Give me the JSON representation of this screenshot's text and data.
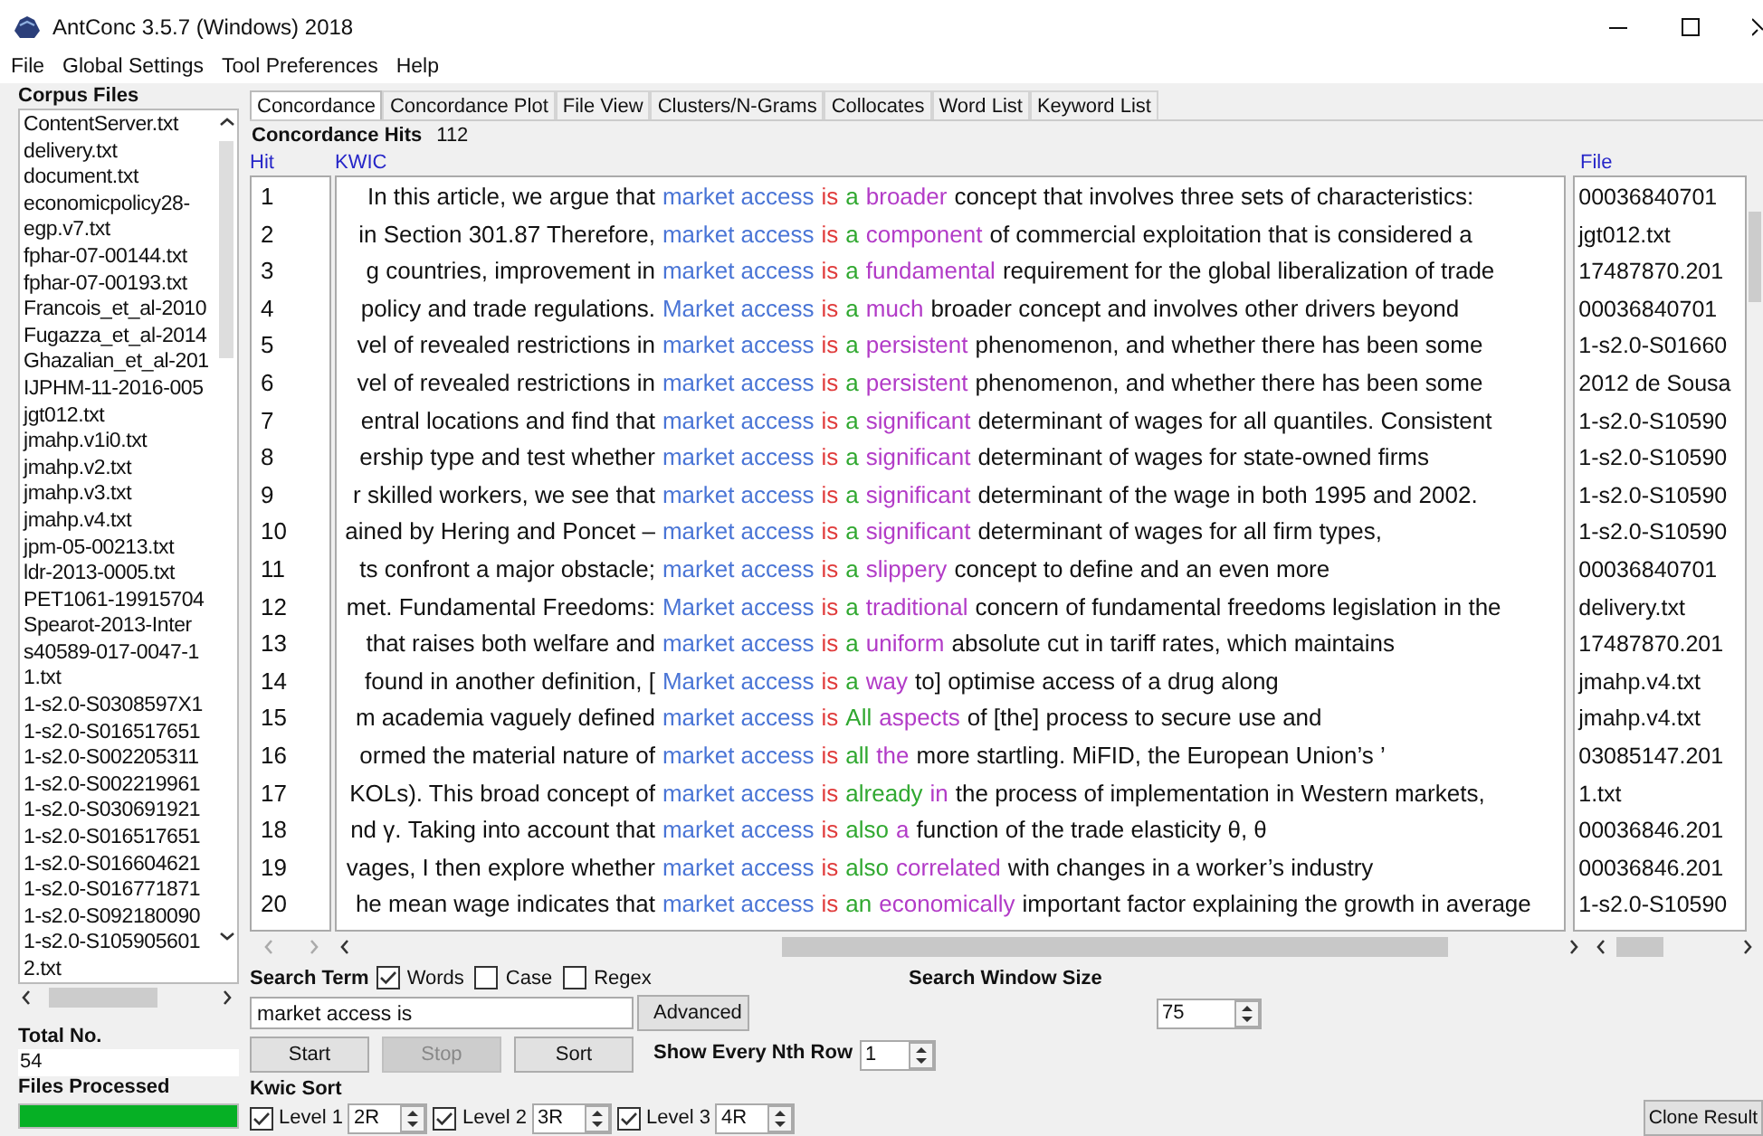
{
  "window": {
    "title": "AntConc 3.5.7 (Windows) 2018"
  },
  "menu": [
    "File",
    "Global Settings",
    "Tool Preferences",
    "Help"
  ],
  "corpus": {
    "label": "Corpus Files",
    "files": [
      "ContentServer.txt",
      "delivery.txt",
      "document.txt",
      "economicpolicy28-",
      "egp.v7.txt",
      "fphar-07-00144.txt",
      "fphar-07-00193.txt",
      "Francois_et_al-2010",
      "Fugazza_et_al-2014",
      "Ghazalian_et_al-201",
      "IJPHM-11-2016-005",
      "jgt012.txt",
      "jmahp.v1i0.txt",
      "jmahp.v2.txt",
      "jmahp.v3.txt",
      "jmahp.v4.txt",
      "jpm-05-00213.txt",
      "ldr-2013-0005.txt",
      "PET1061-19915704",
      "Spearot-2013-Inter",
      "s40589-017-0047-1",
      "1.txt",
      "1-s2.0-S0308597X1",
      "1-s2.0-S016517651",
      "1-s2.0-S002205311",
      "1-s2.0-S002219961",
      "1-s2.0-S030691921",
      "1-s2.0-S016517651",
      "1-s2.0-S016604621",
      "1-s2.0-S016771871",
      "1-s2.0-S092180090",
      "1-s2.0-S105905601",
      "2.txt"
    ],
    "total_label": "Total No.",
    "total": "54",
    "processed_label": "Files Processed",
    "progress": {
      "level": 1
    }
  },
  "tabs": [
    {
      "label": "Concordance",
      "selected": true
    },
    {
      "label": "Concordance Plot",
      "selected": false
    },
    {
      "label": "File View",
      "selected": false
    },
    {
      "label": "Clusters/N-Grams",
      "selected": false
    },
    {
      "label": "Collocates",
      "selected": false
    },
    {
      "label": "Word List",
      "selected": false
    },
    {
      "label": "Keyword List",
      "selected": false
    }
  ],
  "concordance": {
    "hits_label": "Concordance Hits",
    "hits": "112",
    "columns": [
      "Hit",
      "KWIC",
      "File"
    ],
    "rows": [
      {
        "hit": "1",
        "left": "In this article, we argue that",
        "match": "market access",
        "word_1": "is",
        "word_2": "a",
        "word_3": "broader",
        "right": "concept that involves three sets of characteristics:",
        "file": "00036840701"
      },
      {
        "hit": "2",
        "left": "in Section 301.87 Therefore,",
        "match": "market access",
        "word_1": "is",
        "word_2": "a",
        "word_3": "component",
        "right": "of commercial exploitation that is considered a",
        "file": "jgt012.txt"
      },
      {
        "hit": "3",
        "left": "g countries, improvement in",
        "match": "market access",
        "word_1": "is",
        "word_2": "a",
        "word_3": "fundamental",
        "right": "requirement for the global liberalization of trade",
        "file": "17487870.201"
      },
      {
        "hit": "4",
        "left": "policy and trade regulations.",
        "match": "Market access",
        "word_1": "is",
        "word_2": "a",
        "word_3": "much",
        "right": "broader concept and involves other drivers beyond",
        "file": "00036840701"
      },
      {
        "hit": "5",
        "left": "vel of revealed restrictions in",
        "match": "market access",
        "word_1": "is",
        "word_2": "a",
        "word_3": "persistent",
        "right": "phenomenon, and whether there has been some",
        "file": "1-s2.0-S01660"
      },
      {
        "hit": "6",
        "left": "vel of revealed restrictions in",
        "match": "market access",
        "word_1": "is",
        "word_2": "a",
        "word_3": "persistent",
        "right": "phenomenon, and whether there has been some",
        "file": "2012 de Sousa"
      },
      {
        "hit": "7",
        "left": "entral locations and find that",
        "match": "market access",
        "word_1": "is",
        "word_2": "a",
        "word_3": "significant",
        "right": "determinant of wages for all quantiles. Consistent",
        "file": "1-s2.0-S10590"
      },
      {
        "hit": "8",
        "left": "ership type and test whether",
        "match": "market access",
        "word_1": "is",
        "word_2": "a",
        "word_3": "significant",
        "right": "determinant of wages for state-owned firms",
        "file": "1-s2.0-S10590"
      },
      {
        "hit": "9",
        "left": "r skilled workers, we see that",
        "match": "market access",
        "word_1": "is",
        "word_2": "a",
        "word_3": "significant",
        "right": "determinant of the wage in both 1995 and 2002.",
        "file": "1-s2.0-S10590"
      },
      {
        "hit": "10",
        "left": "ained by Hering and Poncet –",
        "match": "market access",
        "word_1": "is",
        "word_2": "a",
        "word_3": "significant",
        "right": "determinant of wages for all firm types,",
        "file": "1-s2.0-S10590"
      },
      {
        "hit": "11",
        "left": "ts confront a major obstacle;",
        "match": "market access",
        "word_1": "is",
        "word_2": "a",
        "word_3": "slippery",
        "right": "concept to define and an even more",
        "file": "00036840701"
      },
      {
        "hit": "12",
        "left": "met. Fundamental Freedoms:",
        "match": "Market access",
        "word_1": "is",
        "word_2": "a",
        "word_3": "traditional",
        "right": "concern of fundamental freedoms legislation in the",
        "file": "delivery.txt"
      },
      {
        "hit": "13",
        "left": "that raises both welfare and",
        "match": "market access",
        "word_1": "is",
        "word_2": "a",
        "word_3": "uniform",
        "right": "absolute cut in tariff rates, which maintains",
        "file": "17487870.201"
      },
      {
        "hit": "14",
        "left": "found in another definition, [",
        "match": "Market access",
        "word_1": "is",
        "word_2": "a",
        "word_3": "way",
        "right": "to] optimise access of a drug along",
        "file": "jmahp.v4.txt"
      },
      {
        "hit": "15",
        "left": "m academia vaguely defined",
        "match": "market access",
        "word_1": "is",
        "word_2": "All",
        "word_3": "aspects",
        "right": "of [the] process to secure use and",
        "file": "jmahp.v4.txt"
      },
      {
        "hit": "16",
        "left": "ormed the material nature of",
        "match": "market access",
        "word_1": "is",
        "word_2": "all",
        "word_3": "the",
        "right": "more startling. MiFID, the European Union’s ’",
        "file": "03085147.201"
      },
      {
        "hit": "17",
        "left": "KOLs). This broad concept of",
        "match": "market access",
        "word_1": "is",
        "word_2": "already",
        "word_3": "in",
        "right": "the process of implementation in Western markets,",
        "file": "1.txt"
      },
      {
        "hit": "18",
        "left": "nd γ. Taking into account that",
        "match": "market access",
        "word_1": "is",
        "word_2": "also",
        "word_3": "a",
        "right": "function of the trade elasticity θ, θ",
        "file": "00036846.201"
      },
      {
        "hit": "19",
        "left": "vages, I then explore whether",
        "match": "market access",
        "word_1": "is",
        "word_2": "also",
        "word_3": "correlated",
        "right": "with changes in a worker’s industry",
        "file": "00036846.201"
      },
      {
        "hit": "20",
        "left": "he mean wage indicates that",
        "match": "market access",
        "word_1": "is",
        "word_2": "an",
        "word_3": "economically",
        "right": "important factor explaining the growth in average",
        "file": "1-s2.0-S10590"
      }
    ]
  },
  "search": {
    "label": "Search Term",
    "options": [
      {
        "label": "Words",
        "checked": true
      },
      {
        "label": "Case",
        "checked": false
      },
      {
        "label": "Regex",
        "checked": false
      }
    ],
    "query": "market access is",
    "advanced": "Advanced",
    "buttons": [
      {
        "label": "Start",
        "disabled": false
      },
      {
        "label": "Stop",
        "disabled": true
      },
      {
        "label": "Sort",
        "disabled": false
      }
    ],
    "nth_row_label": "Show Every Nth Row",
    "nth_row": "1",
    "window_size_label": "Search Window Size",
    "window_size": "75"
  },
  "kwic_sort": {
    "label": "Kwic Sort",
    "levels": [
      {
        "label": "Level 1",
        "checked": true,
        "value": "2R"
      },
      {
        "label": "Level 2",
        "checked": true,
        "value": "3R"
      },
      {
        "label": "Level 3",
        "checked": true,
        "value": "4R"
      }
    ]
  },
  "clone_button": "Clone Result"
}
